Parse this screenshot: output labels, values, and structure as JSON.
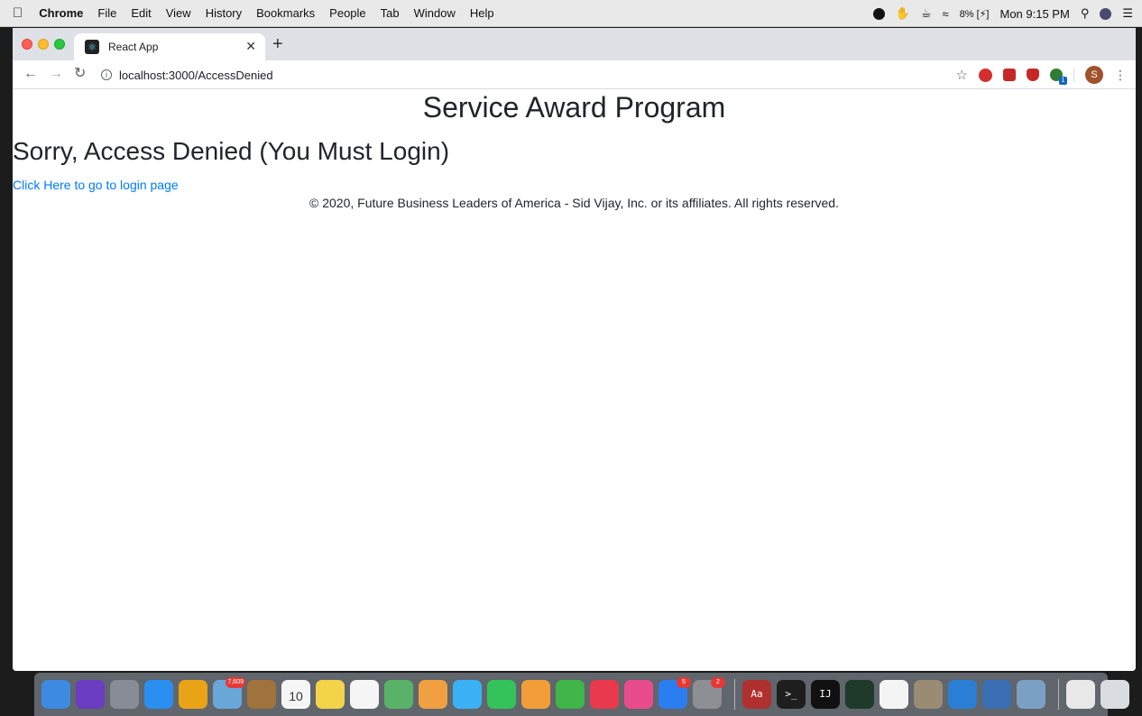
{
  "menubar": {
    "app_name": "Chrome",
    "menus": [
      "File",
      "Edit",
      "View",
      "History",
      "Bookmarks",
      "People",
      "Tab",
      "Window",
      "Help"
    ],
    "battery": "8% [⚡]",
    "clock": "Mon 9:15 PM"
  },
  "browser": {
    "tab_title": "React App",
    "url": "localhost:3000/AccessDenied",
    "profile_initial": "S",
    "ext_badge": "1"
  },
  "page": {
    "title": "Service Award Program",
    "heading": "Sorry, Access Denied (You Must Login)",
    "login_link": "Click Here to go to login page",
    "footer": "© 2020, Future Business Leaders of America - Sid Vijay, Inc. or its affiliates. All rights reserved."
  },
  "dock": {
    "mail_badge": "7,609",
    "calendar_day": "10",
    "appstore_badge": "5",
    "prefs_badge": "2",
    "terminal_glyph": ">_",
    "intellij_glyph": "IJ",
    "dictionary_glyph": "Aa",
    "icons": [
      {
        "name": "finder-icon",
        "color": "#3d8be0"
      },
      {
        "name": "siri-icon",
        "color": "#6a3dc2"
      },
      {
        "name": "launchpad-icon",
        "color": "#888c96"
      },
      {
        "name": "safari-icon",
        "color": "#2a8ff0"
      },
      {
        "name": "chrome-icon",
        "color": "#e8a317"
      },
      {
        "name": "preview-icon",
        "color": "#6aa6d8"
      },
      {
        "name": "notebook-icon",
        "color": "#a0723c"
      },
      {
        "name": "calendar-icon",
        "color": "#f5f5f5"
      },
      {
        "name": "notes-icon",
        "color": "#f3d34a"
      },
      {
        "name": "reminders-icon",
        "color": "#f5f5f5"
      },
      {
        "name": "maps-icon",
        "color": "#58b368"
      },
      {
        "name": "photos-icon",
        "color": "#f0a040"
      },
      {
        "name": "messages-icon",
        "color": "#3ab0f5"
      },
      {
        "name": "facetime-icon",
        "color": "#33c35a"
      },
      {
        "name": "pages-icon",
        "color": "#f29d38"
      },
      {
        "name": "numbers-icon",
        "color": "#3fb54a"
      },
      {
        "name": "news-icon",
        "color": "#e83a4c"
      },
      {
        "name": "itunes-icon",
        "color": "#e84c8c"
      },
      {
        "name": "app-store-icon",
        "color": "#2a7ef0"
      },
      {
        "name": "system-preferences-icon",
        "color": "#8d8f94"
      }
    ],
    "icons_right": [
      {
        "name": "dictionary-icon",
        "color": "#b03030"
      },
      {
        "name": "terminal-icon",
        "color": "#1e1e1e"
      },
      {
        "name": "intellij-icon",
        "color": "#111111"
      },
      {
        "name": "activity-monitor-icon",
        "color": "#1f3a2a"
      },
      {
        "name": "textedit-icon",
        "color": "#f4f4f4"
      },
      {
        "name": "keychain-icon",
        "color": "#9a8c74"
      },
      {
        "name": "vscode-icon",
        "color": "#2a7fd4"
      },
      {
        "name": "quicktime-icon",
        "color": "#3b6fb5"
      },
      {
        "name": "screenshot-icon",
        "color": "#7aa0c4"
      }
    ],
    "icons_end": [
      {
        "name": "finder-window-icon",
        "color": "#e8e8e8"
      },
      {
        "name": "trash-icon",
        "color": "#d9dde2"
      }
    ]
  }
}
